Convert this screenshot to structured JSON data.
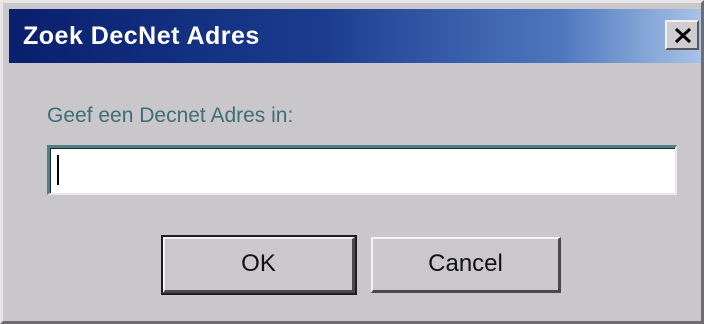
{
  "window": {
    "title": "Zoek DecNet Adres",
    "close_icon": "close-icon"
  },
  "form": {
    "prompt": "Geef een Decnet Adres in:",
    "address_value": "",
    "address_placeholder": ""
  },
  "buttons": {
    "ok_label": "OK",
    "cancel_label": "Cancel"
  },
  "colors": {
    "title_gradient_start": "#0a1f6e",
    "title_gradient_end": "#a7c3e6",
    "dialog_face": "#c9c7ca",
    "prompt_text": "#3d6e78"
  }
}
